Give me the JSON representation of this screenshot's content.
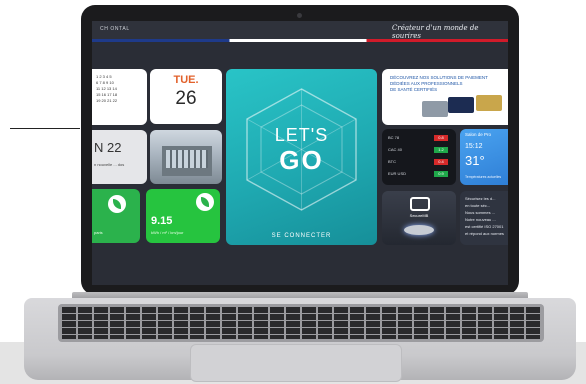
{
  "screen": {
    "topbar_title": "CH ONTAL",
    "tagline": "Créateur d'un monde de sourires"
  },
  "tiles": {
    "calendar": {
      "grid": [
        "1 2 3 4 5",
        "6 7 8 9 10",
        "11 12 13 14",
        "15 16 17 18",
        "19 20 21 22"
      ]
    },
    "date": {
      "day": "TUE.",
      "number": "26"
    },
    "promo_left": {
      "big": "N 22",
      "small": "n nouvelle ... dos"
    },
    "green_a": {
      "caption": "paris"
    },
    "green_b": {
      "value": "9.15",
      "caption": "kWh / m² / km/jour"
    },
    "letsgo": {
      "title": "LET'S",
      "go": "GO",
      "connect": "SE CONNECTER"
    },
    "health": {
      "lines": [
        "DÉCOUVREZ NOS SOLUTIONS DE PAIEMENT",
        "DÉDIÉES AUX PROFESSIONNELS",
        "DE SANTÉ CERTIFIÉS"
      ]
    },
    "market": {
      "rows": [
        {
          "label": "BC 78",
          "value": "0.8"
        },
        {
          "label": "CAC 40",
          "value": "1.2"
        },
        {
          "label": "BTC",
          "value": "0.4"
        },
        {
          "label": "EUR USD",
          "value": "0.9"
        }
      ]
    },
    "weather": {
      "head": "Salon de Pro",
      "time": "15:12",
      "temp": "31°",
      "foot": "Températures actuelles"
    },
    "secure": {
      "name": "SecureMB"
    },
    "iso": {
      "lines": [
        "Sécurisez les d...",
        "en toute séc...",
        "Nous sommes ...",
        "Notre nouveau ...",
        "est certifié ISO 27001",
        "et répond aux normes"
      ]
    }
  }
}
